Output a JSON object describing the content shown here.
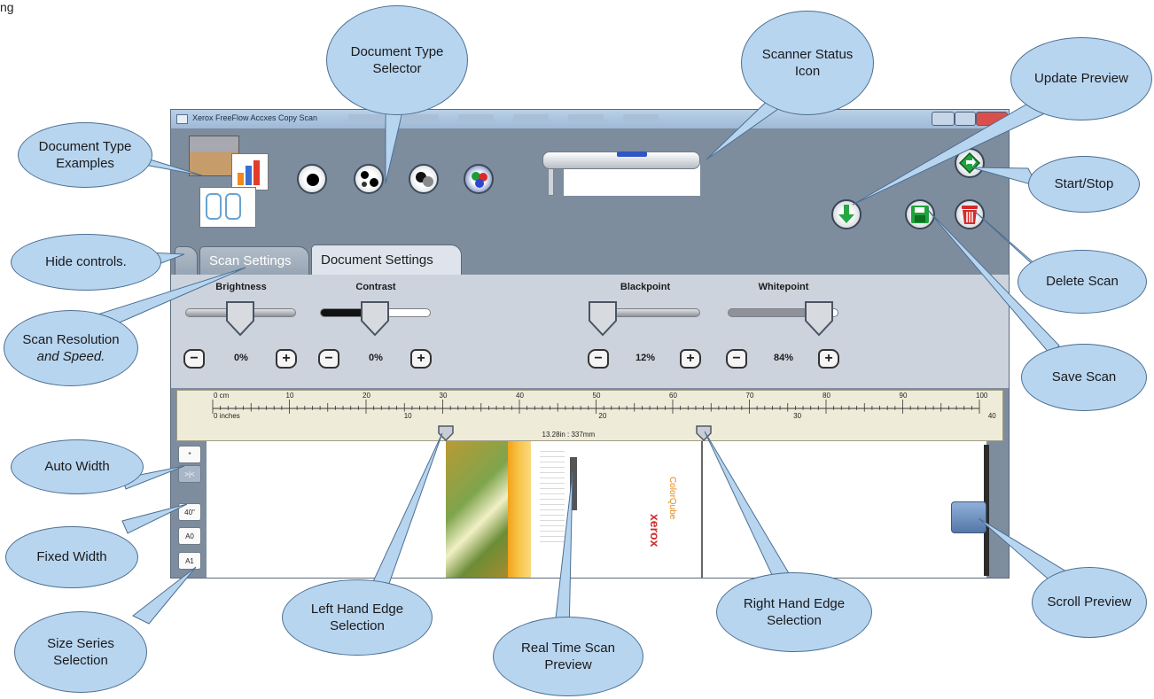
{
  "page": {
    "caption": "ng"
  },
  "window": {
    "title": "Xerox FreeFlow Accxes Copy Scan"
  },
  "tabs": [
    {
      "label": ""
    },
    {
      "label": "Scan Settings"
    },
    {
      "label": "Document Settings"
    }
  ],
  "controls": {
    "brightness": {
      "label": "Brightness",
      "value": "0%",
      "level": 0.5
    },
    "contrast": {
      "label": "Contrast",
      "value": "0%",
      "level": 0.5
    },
    "blackpoint": {
      "label": "Blackpoint",
      "value": "12%",
      "level": 0.12
    },
    "whitepoint": {
      "label": "Whitepoint",
      "value": "84%",
      "level": 0.84
    }
  },
  "ruler": {
    "cm_unit": "0 cm",
    "cm_ticks": [
      "10",
      "20",
      "30",
      "40",
      "50",
      "60",
      "70",
      "80",
      "90",
      "100"
    ],
    "inch_unit": "0 inches",
    "inch_ticks": [
      "10",
      "20",
      "30",
      "40"
    ],
    "selection": "13.28in : 337mm",
    "left_edge_in": 12.0,
    "right_edge_in": 25.28
  },
  "size_buttons": [
    "*",
    ">|<",
    "40\"",
    "A0",
    "A1"
  ],
  "preview": {
    "doc_text": [
      "xerox",
      "ColorQube"
    ]
  },
  "callouts": {
    "document_type_examples": [
      "Document Type",
      "Examples"
    ],
    "document_type_selector": [
      "Document Type",
      "Selector"
    ],
    "scanner_status_icon": [
      "Scanner Status",
      "Icon"
    ],
    "update_preview": [
      "Update Preview"
    ],
    "start_stop": [
      "Start/Stop"
    ],
    "delete_scan": [
      "Delete Scan"
    ],
    "save_scan": [
      "Save Scan"
    ],
    "hide_controls": [
      "Hide controls."
    ],
    "scan_resolution": [
      "Scan Resolution",
      "and Speed."
    ],
    "auto_width": [
      "Auto Width"
    ],
    "fixed_width": [
      "Fixed Width"
    ],
    "size_series": [
      "Size Series",
      "Selection"
    ],
    "left_edge": [
      "Left Hand Edge",
      "Selection"
    ],
    "real_time_preview": [
      "Real Time Scan",
      "Preview"
    ],
    "right_edge": [
      "Right Hand Edge",
      "Selection"
    ],
    "scroll_preview": [
      "Scroll Preview"
    ]
  },
  "icons": {
    "update": "arrow-down-icon",
    "start": "start-stop-icon",
    "save": "floppy-disk-icon",
    "delete": "trash-icon"
  }
}
